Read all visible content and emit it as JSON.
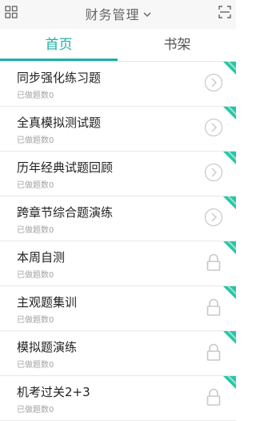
{
  "header": {
    "title": "财务管理",
    "left_icon": "grid-icon",
    "right_icon": "scan-icon"
  },
  "tabs": [
    {
      "label": "首页",
      "active": true
    },
    {
      "label": "书架",
      "active": false
    }
  ],
  "colors": {
    "accent": "#1db0a6",
    "ribbon": "#26c6a6",
    "lock": "#c8c8c8"
  },
  "list": {
    "items": [
      {
        "title": "同步强化练习题",
        "sub": "已做题数0",
        "action": "chevron-right-icon",
        "ribbon": "corner-badge"
      },
      {
        "title": "全真模拟测试题",
        "sub": "已做题数0",
        "action": "chevron-right-icon",
        "ribbon": "corner-badge"
      },
      {
        "title": "历年经典试题回顾",
        "sub": "已做题数0",
        "action": "chevron-right-icon",
        "ribbon": "corner-badge"
      },
      {
        "title": "跨章节综合题演练",
        "sub": "已做题数0",
        "action": "chevron-right-icon",
        "ribbon": "corner-badge"
      },
      {
        "title": "本周自测",
        "sub": "已做题数0",
        "action": "lock-icon",
        "ribbon": "corner-badge"
      },
      {
        "title": "主观题集训",
        "sub": "已做题数0",
        "action": "lock-icon",
        "ribbon": "corner-badge"
      },
      {
        "title": "模拟题演练",
        "sub": "已做题数0",
        "action": "lock-icon",
        "ribbon": "corner-badge"
      },
      {
        "title": "机考过关2+3",
        "sub": "已做题数0",
        "action": "lock-icon",
        "ribbon": "corner-badge"
      }
    ]
  }
}
